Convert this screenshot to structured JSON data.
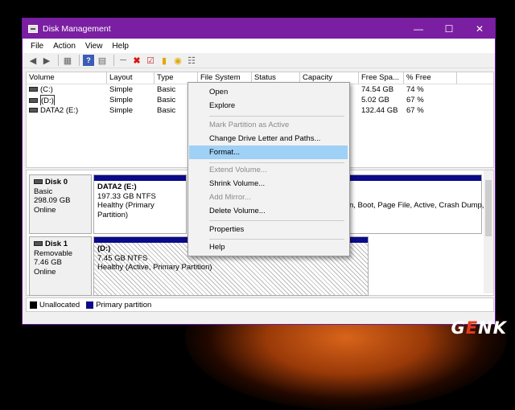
{
  "window": {
    "title": "Disk Management",
    "controls": [
      "—",
      "☐",
      "✕"
    ]
  },
  "menu": [
    "File",
    "Action",
    "View",
    "Help"
  ],
  "toolbar": [
    "back-icon",
    "forward-icon",
    "console-tree-icon",
    "help-icon",
    "properties-icon",
    "connect-icon",
    "delete-icon",
    "check-icon",
    "import-icon",
    "rescan-icon",
    "list-icon"
  ],
  "volume_list": {
    "columns": [
      "Volume",
      "Layout",
      "Type",
      "File System",
      "Status",
      "Capacity",
      "Free Spa...",
      "% Free"
    ],
    "rows": [
      {
        "volume": "(C:)",
        "layout": "Simple",
        "type": "Basic",
        "free": "74.54 GB",
        "pct": "74 %"
      },
      {
        "volume": "(D:)",
        "layout": "Simple",
        "type": "Basic",
        "free": "5.02 GB",
        "pct": "67 %"
      },
      {
        "volume": "DATA2 (E:)",
        "layout": "Simple",
        "type": "Basic",
        "free": "132.44 GB",
        "pct": "67 %"
      }
    ]
  },
  "disks": [
    {
      "name": "Disk 0",
      "type": "Basic",
      "size": "298.09 GB",
      "status": "Online",
      "partition": {
        "name": "DATA2  (E:)",
        "detail": "197.33 GB NTFS",
        "health": "Healthy (Primary Partition)"
      },
      "partition2_health": "n, Boot, Page File, Active, Crash Dump,"
    },
    {
      "name": "Disk 1",
      "type": "Removable",
      "size": "7.46 GB",
      "status": "Online",
      "partition": {
        "name": "(D:)",
        "detail": "7.45 GB NTFS",
        "health": "Healthy (Active, Primary Partition)"
      }
    }
  ],
  "legend": [
    {
      "label": "Unallocated",
      "color": "#000000"
    },
    {
      "label": "Primary partition",
      "color": "#0a0a8a"
    }
  ],
  "context_menu": [
    {
      "label": "Open",
      "enabled": true
    },
    {
      "label": "Explore",
      "enabled": true
    },
    {
      "label": "Mark Partition as Active",
      "enabled": false
    },
    {
      "label": "Change Drive Letter and Paths...",
      "enabled": true
    },
    {
      "label": "Format...",
      "enabled": true,
      "highlighted": true
    },
    {
      "label": "Extend Volume...",
      "enabled": false
    },
    {
      "label": "Shrink Volume...",
      "enabled": true
    },
    {
      "label": "Add Mirror...",
      "enabled": false
    },
    {
      "label": "Delete Volume...",
      "enabled": true
    },
    {
      "label": "Properties",
      "enabled": true
    },
    {
      "label": "Help",
      "enabled": true
    }
  ],
  "watermark": "GENK",
  "colors": {
    "title_bar": "#7b1fa2",
    "highlight": "#9fd0f5",
    "primary_partition": "#0a0a8a"
  }
}
